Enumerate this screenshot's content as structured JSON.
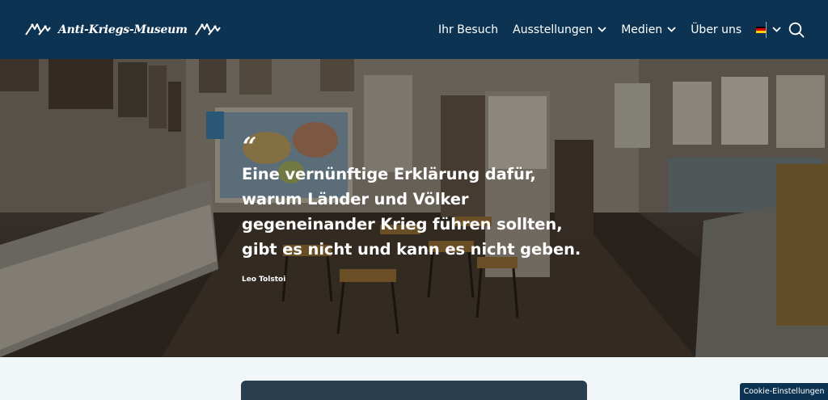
{
  "header": {
    "logo_text": "Anti-Kriegs-Museum",
    "nav": [
      {
        "label": "Ihr Besuch"
      },
      {
        "label": "Ausstellungen"
      },
      {
        "label": "Medien"
      },
      {
        "label": "Über uns"
      }
    ],
    "language_icon": "german-flag-icon",
    "search_icon": "search-icon"
  },
  "hero": {
    "quote_mark": "“",
    "quote": "Eine vernünftige Erklärung dafür, warum Länder und Völker gegeneinander Krieg führen sollten, gibt es nicht und kann es nicht geben.",
    "author": "Leo Tolstoi"
  },
  "cookie": {
    "label": "Cookie-Einstellungen"
  },
  "colors": {
    "header_bg": "#0d3352",
    "page_bg": "#f1f6f8",
    "text_on_dark": "#ffffff"
  }
}
